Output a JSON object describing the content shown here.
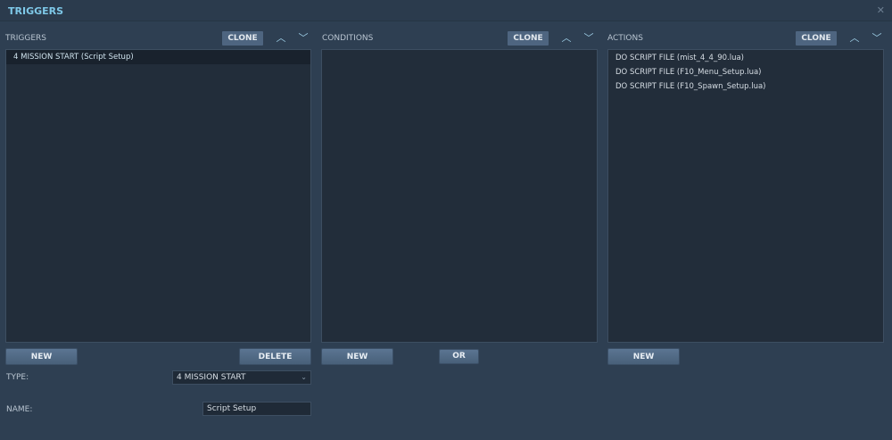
{
  "window": {
    "title": "TRIGGERS",
    "close_icon": "close-icon"
  },
  "triggers": {
    "label": "TRIGGERS",
    "clone": "CLONE",
    "items": [
      "4 MISSION START (Script Setup)"
    ],
    "new": "NEW",
    "delete": "DELETE"
  },
  "conditions": {
    "label": "CONDITIONS",
    "clone": "CLONE",
    "items": [],
    "new": "NEW",
    "or": "OR"
  },
  "actions": {
    "label": "ACTIONS",
    "clone": "CLONE",
    "items": [
      "DO SCRIPT FILE (mist_4_4_90.lua)",
      "DO SCRIPT FILE (F10_Menu_Setup.lua)",
      "DO SCRIPT FILE (F10_Spawn_Setup.lua)"
    ],
    "new": "NEW"
  },
  "form": {
    "type_label": "TYPE:",
    "type_value": "4 MISSION START",
    "name_label": "NAME:",
    "name_value": "Script Setup"
  }
}
